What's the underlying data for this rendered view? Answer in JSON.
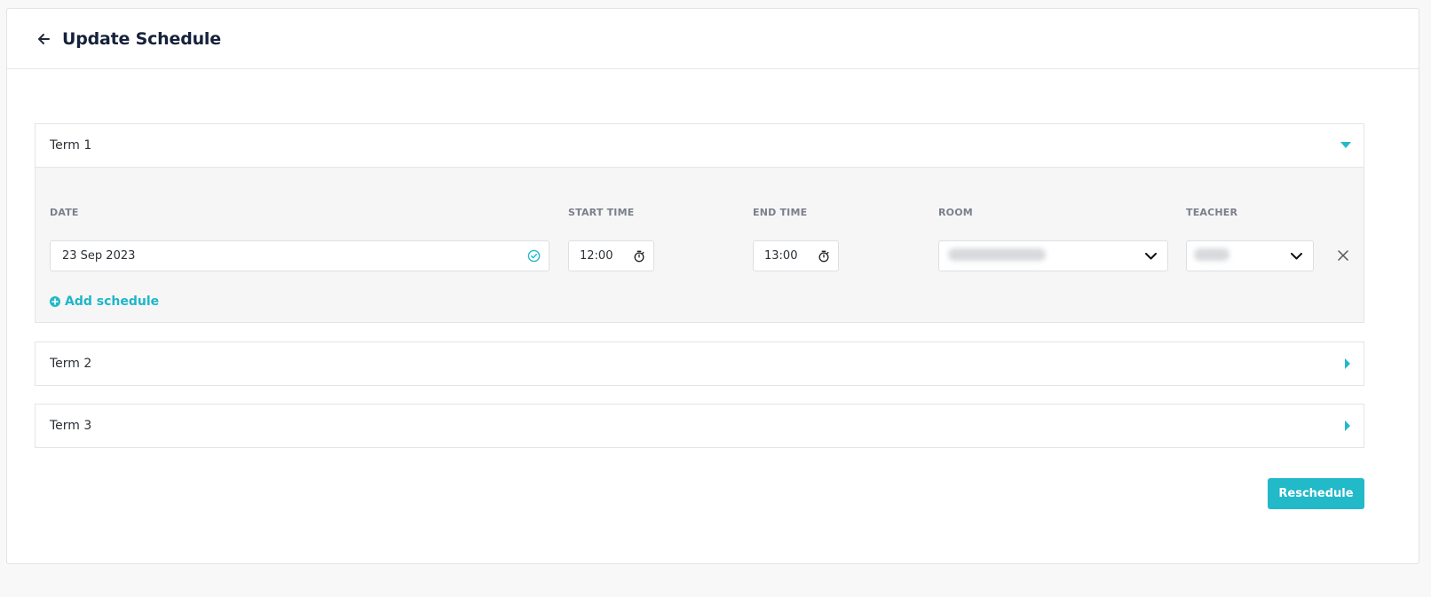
{
  "header": {
    "title": "Update Schedule",
    "back_icon": "arrow-left-icon"
  },
  "colors": {
    "accent": "#22b9c9",
    "title": "#16213a",
    "label": "#7a7f8a",
    "panel_bg": "#f6f6f6"
  },
  "terms": [
    {
      "title": "Term 1",
      "expanded": true,
      "columns": {
        "date": "DATE",
        "start_time": "START TIME",
        "end_time": "END TIME",
        "room": "ROOM",
        "teacher": "TEACHER"
      },
      "schedules": [
        {
          "date": "23 Sep 2023",
          "date_valid": true,
          "start_time": "12:00",
          "end_time": "13:00",
          "room": "",
          "teacher": ""
        }
      ],
      "add_schedule_label": "Add schedule"
    },
    {
      "title": "Term 2",
      "expanded": false
    },
    {
      "title": "Term 3",
      "expanded": false
    }
  ],
  "footer": {
    "reschedule_label": "Reschedule"
  }
}
